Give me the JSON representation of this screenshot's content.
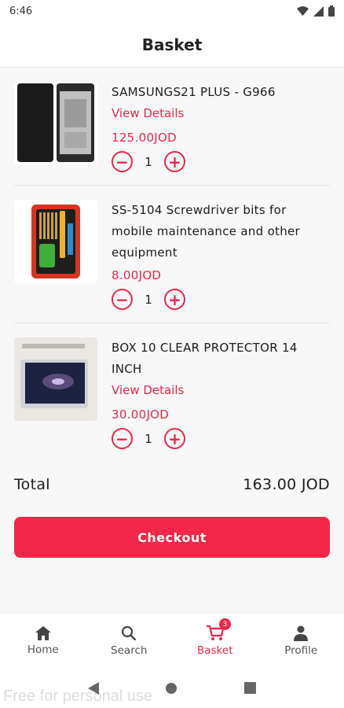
{
  "status": {
    "time": "6:46"
  },
  "header": {
    "title": "Basket"
  },
  "items": [
    {
      "name": "SAMSUNGS21 PLUS - G966",
      "details": "View Details",
      "price": "125.00JOD",
      "qty": "1"
    },
    {
      "name": "SS-5104 Screwdriver bits for mobile maintenance and other equipment",
      "price": "8.00JOD",
      "qty": "1"
    },
    {
      "name": " BOX 10 CLEAR PROTECTOR 14 INCH",
      "details": "View Details",
      "price": "30.00JOD",
      "qty": "1"
    }
  ],
  "total": {
    "label": "Total",
    "value": "163.00 JOD"
  },
  "checkout": {
    "label": "Checkout"
  },
  "nav": {
    "home": "Home",
    "search": "Search",
    "basket": "Basket",
    "basket_count": "3",
    "profile": "Profile"
  },
  "watermark": "Free for personal use",
  "colors": {
    "accent": "#ee2649"
  }
}
